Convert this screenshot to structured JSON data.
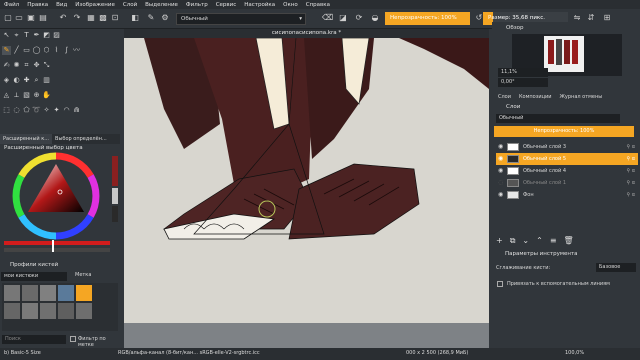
{
  "menu": [
    "Файл",
    "Правка",
    "Вид",
    "Изображение",
    "Слой",
    "Выделение",
    "Фильтр",
    "Сервис",
    "Настройка",
    "Окно",
    "Справка"
  ],
  "toolbar": {
    "brush_preset": "Обычный",
    "opacity": "Непрозрачность: 100%",
    "size": "Размер: 35,68 пикс."
  },
  "canvas": {
    "title": "сисипопасисипопа.kra *"
  },
  "left_tabs": [
    "Расширенный к...",
    "Выбор определён..."
  ],
  "color_docker": {
    "title": "Расширенный выбор цвета"
  },
  "brush_profiles": {
    "title": "Профили кистей",
    "tag": "мои кистюки",
    "tag_label": "Метка",
    "search_placeholder": "Поиск",
    "filter_by_tag": "Фильтр по метке"
  },
  "overview": {
    "title": "Обзор",
    "zoom": "11,1%",
    "rotation": "0,00°"
  },
  "layers_panel": {
    "tabs": [
      "Слои",
      "Композиции",
      "Журнал отмены"
    ],
    "title": "Слои",
    "blend_mode": "Обычный",
    "opacity": "Непрозрачность: 100%",
    "layers": [
      {
        "name": "Обычный слой 3",
        "selected": false,
        "visible": true
      },
      {
        "name": "Обычный слой 5",
        "selected": true,
        "visible": true
      },
      {
        "name": "Обычный слой 4",
        "selected": false,
        "visible": true
      },
      {
        "name": "Обычный слой 1",
        "selected": false,
        "visible": false
      },
      {
        "name": "Фон",
        "selected": false,
        "visible": true
      }
    ]
  },
  "tool_options": {
    "title": "Параметры инструмента",
    "smoothing_label": "Сглаживание кисти:",
    "smoothing_value": "Базовое",
    "snap_label": "Привязать к вспомогательным линиям"
  },
  "status": {
    "brush": "b) Basic-5 Size",
    "color_info": "RGB/альфа-канал (8-бит/кан...   sRGB-elle-V2-srgbtrc.icc",
    "dimensions": "000 x 2 500 (268,9 МиБ)",
    "zoom": "100,0%"
  },
  "colors": {
    "accent": "#f5a623",
    "panel": "#31363b",
    "canvas_bg": "#d8d6cf",
    "boot_dark": "#3a1c1c",
    "boot_mid": "#4e2424"
  }
}
